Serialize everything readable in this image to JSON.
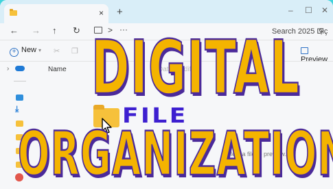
{
  "tab": {
    "close_glyph": "×",
    "new_tab_glyph": "+"
  },
  "window_controls": {
    "minimize": "–",
    "maximize": "☐",
    "close": "✕"
  },
  "nav": {
    "back": "←",
    "forward": "→",
    "up": "↑",
    "refresh": "↻",
    "address_chevron": ">",
    "address_more": "···"
  },
  "search": {
    "placeholder": "Search 2025 Diç"
  },
  "commandbar": {
    "new_label": "New",
    "preview_label": "Preview"
  },
  "file_list": {
    "column_name": "Name",
    "column_date": "Date modified",
    "empty_hint": "Select a file to preview."
  },
  "overlay": {
    "line1": "DIGITAL",
    "line2": "FILE",
    "line3": "ORGANIZATION"
  },
  "colors": {
    "background": "#3fd3dc",
    "title_fill": "#f4b400",
    "title_outline": "#4b2a9a",
    "file_word": "#3d1fd0",
    "folder": "#f6c13b"
  },
  "icons": [
    "folder-icon",
    "close-icon",
    "plus-icon",
    "back-arrow-icon",
    "forward-arrow-icon",
    "up-arrow-icon",
    "refresh-icon",
    "monitor-icon",
    "search-icon",
    "cut-icon",
    "copy-icon",
    "preview-pane-icon",
    "cloud-icon",
    "download-icon",
    "music-icon",
    "mouse-cursor-icon"
  ]
}
